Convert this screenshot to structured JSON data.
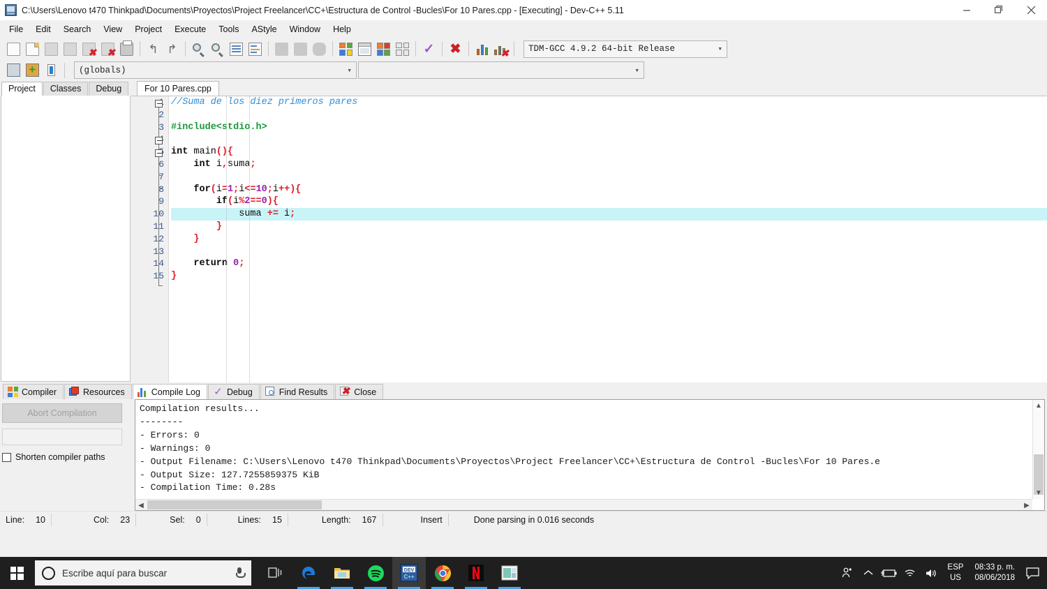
{
  "window": {
    "title": "C:\\Users\\Lenovo t470 Thinkpad\\Documents\\Proyectos\\Project Freelancer\\CC+\\Estructura de Control -Bucles\\For 10 Pares.cpp - [Executing] - Dev-C++ 5.11",
    "app_icon": "devcpp-icon",
    "minimize": "—",
    "maximize": "❐",
    "close": "✕"
  },
  "menu": {
    "items": [
      "File",
      "Edit",
      "Search",
      "View",
      "Project",
      "Execute",
      "Tools",
      "AStyle",
      "Window",
      "Help"
    ]
  },
  "toolbar": {
    "groups": [
      [
        "new-file-icon",
        "open-file-icon",
        "save-file-icon",
        "save-all-icon",
        "close-file-icon",
        "close-all-icon",
        "print-icon"
      ],
      [
        "undo-icon",
        "redo-icon"
      ],
      [
        "find-icon",
        "replace-icon",
        "goto-line-icon",
        "goto-function-icon"
      ],
      [
        "back-icon",
        "forward-icon",
        "toggle-bookmark-icon"
      ],
      [
        "compile-icon",
        "run-icon",
        "compile-and-run-icon",
        "rebuild-all-icon",
        "syntax-check-icon",
        "stop-execution-icon",
        "profile-icon",
        "delete-profile-icon"
      ]
    ],
    "compiler_select": "TDM-GCC 4.9.2 64-bit Release",
    "project_icons": [
      "project-manager-icon",
      "add-to-project-icon",
      "class-browser-icon"
    ],
    "globals_select": "(globals)",
    "member_select": ""
  },
  "left_panel": {
    "tabs": [
      {
        "label": "Project",
        "active": true
      },
      {
        "label": "Classes",
        "active": false
      },
      {
        "label": "Debug",
        "active": false
      }
    ]
  },
  "editor": {
    "tab": "For 10 Pares.cpp",
    "current_line": 10,
    "lines": [
      {
        "no": "1",
        "tokens": [
          {
            "t": "//Suma de los diez primeros pares",
            "c": "cm"
          }
        ]
      },
      {
        "no": "2",
        "tokens": []
      },
      {
        "no": "3",
        "tokens": [
          {
            "t": "#include<stdio.h>",
            "c": "pp"
          }
        ]
      },
      {
        "no": "4",
        "tokens": []
      },
      {
        "no": "5",
        "tokens": [
          {
            "t": "int",
            "c": "k"
          },
          {
            "t": " ",
            "c": "id"
          },
          {
            "t": "main",
            "c": "id"
          },
          {
            "t": "(){",
            "c": "p"
          }
        ]
      },
      {
        "no": "6",
        "tokens": [
          {
            "t": "    ",
            "c": "id"
          },
          {
            "t": "int",
            "c": "k"
          },
          {
            "t": " ",
            "c": "id"
          },
          {
            "t": "i",
            "c": "id"
          },
          {
            "t": ",",
            "c": "p"
          },
          {
            "t": "suma",
            "c": "id"
          },
          {
            "t": ";",
            "c": "p"
          }
        ]
      },
      {
        "no": "7",
        "tokens": []
      },
      {
        "no": "8",
        "tokens": [
          {
            "t": "    ",
            "c": "id"
          },
          {
            "t": "for",
            "c": "k"
          },
          {
            "t": "(",
            "c": "p"
          },
          {
            "t": "i",
            "c": "id"
          },
          {
            "t": "=",
            "c": "p"
          },
          {
            "t": "1",
            "c": "n"
          },
          {
            "t": ";",
            "c": "p"
          },
          {
            "t": "i",
            "c": "id"
          },
          {
            "t": "<=",
            "c": "p"
          },
          {
            "t": "10",
            "c": "n"
          },
          {
            "t": ";",
            "c": "p"
          },
          {
            "t": "i",
            "c": "id"
          },
          {
            "t": "++){",
            "c": "p"
          }
        ]
      },
      {
        "no": "9",
        "tokens": [
          {
            "t": "        ",
            "c": "id"
          },
          {
            "t": "if",
            "c": "k"
          },
          {
            "t": "(",
            "c": "p"
          },
          {
            "t": "i",
            "c": "id"
          },
          {
            "t": "%",
            "c": "p"
          },
          {
            "t": "2",
            "c": "n"
          },
          {
            "t": "==",
            "c": "p"
          },
          {
            "t": "0",
            "c": "n"
          },
          {
            "t": "){",
            "c": "p"
          }
        ]
      },
      {
        "no": "10",
        "tokens": [
          {
            "t": "            ",
            "c": "id"
          },
          {
            "t": "suma",
            "c": "id"
          },
          {
            "t": " ",
            "c": "id"
          },
          {
            "t": "+=",
            "c": "p"
          },
          {
            "t": " ",
            "c": "id"
          },
          {
            "t": "i",
            "c": "id"
          },
          {
            "t": ";",
            "c": "p"
          }
        ],
        "highlight": true
      },
      {
        "no": "11",
        "tokens": [
          {
            "t": "        ",
            "c": "id"
          },
          {
            "t": "}",
            "c": "p"
          }
        ]
      },
      {
        "no": "12",
        "tokens": [
          {
            "t": "    ",
            "c": "id"
          },
          {
            "t": "}",
            "c": "p"
          }
        ]
      },
      {
        "no": "13",
        "tokens": []
      },
      {
        "no": "14",
        "tokens": [
          {
            "t": "    ",
            "c": "id"
          },
          {
            "t": "return",
            "c": "k"
          },
          {
            "t": " ",
            "c": "id"
          },
          {
            "t": "0",
            "c": "n"
          },
          {
            "t": ";",
            "c": "p"
          }
        ]
      },
      {
        "no": "15",
        "tokens": [
          {
            "t": "}",
            "c": "p"
          }
        ]
      }
    ]
  },
  "bottom_panel": {
    "tabs": [
      {
        "label": "Compiler",
        "icon": "compiler-icon",
        "active": false
      },
      {
        "label": "Resources",
        "icon": "resources-icon",
        "active": false
      },
      {
        "label": "Compile Log",
        "icon": "compile-log-icon",
        "active": true
      },
      {
        "label": "Debug",
        "icon": "debug-check-icon",
        "active": false
      },
      {
        "label": "Find Results",
        "icon": "find-results-icon",
        "active": false
      },
      {
        "label": "Close",
        "icon": "close-panel-icon",
        "active": false
      }
    ],
    "abort_button": "Abort Compilation",
    "shorten_paths_label": "Shorten compiler paths",
    "shorten_paths_checked": false,
    "log": "Compilation results...\n--------\n- Errors: 0\n- Warnings: 0\n- Output Filename: C:\\Users\\Lenovo t470 Thinkpad\\Documents\\Proyectos\\Project Freelancer\\CC+\\Estructura de Control -Bucles\\For 10 Pares.e\n- Output Size: 127.7255859375 KiB\n- Compilation Time: 0.28s"
  },
  "statusbar": {
    "line_label": "Line:",
    "line_value": "10",
    "col_label": "Col:",
    "col_value": "23",
    "sel_label": "Sel:",
    "sel_value": "0",
    "lines_label": "Lines:",
    "lines_value": "15",
    "length_label": "Length:",
    "length_value": "167",
    "mode": "Insert",
    "message": "Done parsing in 0.016 seconds"
  },
  "taskbar": {
    "start_icon": "windows-start-icon",
    "search_placeholder": "Escribe aquí para buscar",
    "mic_icon": "microphone-icon",
    "apps": [
      {
        "name": "task-view-icon",
        "active": false,
        "open": false
      },
      {
        "name": "edge-browser-icon",
        "active": false,
        "open": true
      },
      {
        "name": "file-explorer-icon",
        "active": false,
        "open": true
      },
      {
        "name": "spotify-icon",
        "active": false,
        "open": true
      },
      {
        "name": "devcpp-icon",
        "active": true,
        "open": true
      },
      {
        "name": "chrome-icon",
        "active": false,
        "open": true
      },
      {
        "name": "netflix-icon",
        "active": false,
        "open": true
      },
      {
        "name": "calculator-icon",
        "active": false,
        "open": true
      }
    ],
    "tray": [
      "people-icon",
      "show-hidden-icons-icon",
      "battery-charging-icon",
      "wifi-icon",
      "volume-icon"
    ],
    "language_top": "ESP",
    "language_bottom": "US",
    "time": "08:33 p. m.",
    "date": "08/06/2018",
    "notification_icon": "action-center-icon"
  },
  "colors": {
    "highlight_line": "#c8f4f7",
    "comment": "#2f8fd8",
    "preprocessor": "#1a9a3c",
    "punctuation": "#e01b24",
    "number": "#9b1fb0",
    "taskbar_bg": "#1f1f1f",
    "accent": "#4aa3e8"
  }
}
